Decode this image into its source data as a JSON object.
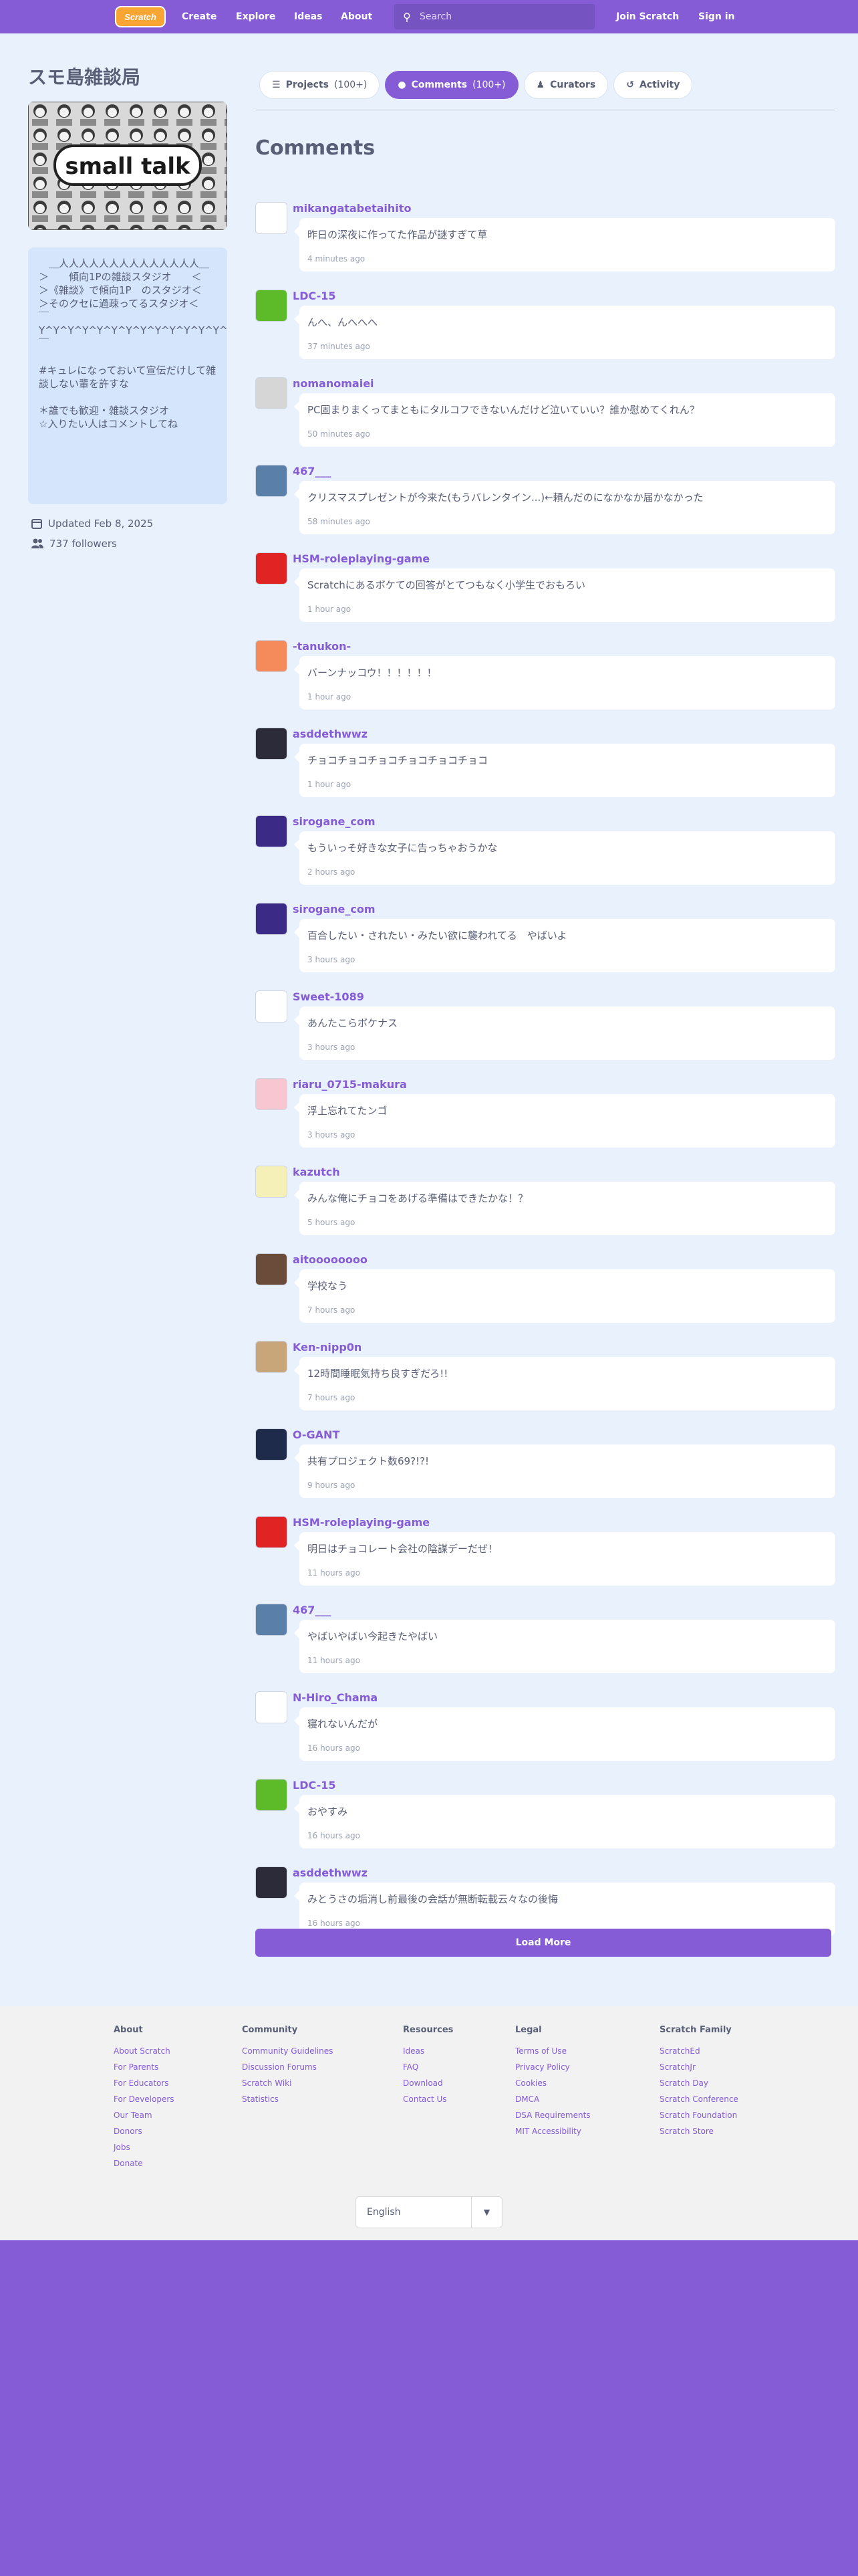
{
  "nav": {
    "logo": "Scratch",
    "create": "Create",
    "explore": "Explore",
    "ideas": "Ideas",
    "about": "About",
    "search_placeholder": "Search",
    "join": "Join Scratch",
    "signin": "Sign in"
  },
  "studio": {
    "title": "スモ島雑談局",
    "thumb_text": "small talk",
    "description": "　＿人人人人人人人人人人人人人人＿\n＞　　傾向1Pの雑談スタジオ　　＜\n＞《雑談》で傾向1P　のスタジオ＜\n＞そのクセに過疎ってるスタジオ＜\n￣Y^Y^Y^Y^Y^Y^Y^Y^Y^Y^Y^Y^Y^Y^￣\n\n#キュレになっておいて宣伝だけして雑談しない輩を許すな\n\n＊誰でも歓迎・雑談スタジオ\n☆入りたい人はコメントしてね",
    "updated": "Updated Feb 8, 2025",
    "followers": "737 followers"
  },
  "tabs": [
    {
      "label": "Projects",
      "count": "(100+)"
    },
    {
      "label": "Comments",
      "count": "(100+)"
    },
    {
      "label": "Curators",
      "count": ""
    },
    {
      "label": "Activity",
      "count": ""
    }
  ],
  "comments_heading": "Comments",
  "comments": [
    {
      "user": "mikangatabetaihito",
      "text": "昨日の深夜に作ってた作品が謎すぎて草",
      "time": "4 minutes ago",
      "avatar_color": "#ffffff"
    },
    {
      "user": "LDC-15",
      "text": "んへ、んへへへ",
      "time": "37 minutes ago",
      "avatar_color": "#5dbb2a"
    },
    {
      "user": "nomanomaiei",
      "text": "PC固まりまくってまともにタルコフできないんだけど泣いていい？誰か慰めてくれん？",
      "time": "50 minutes ago",
      "avatar_color": "#d6d6d6"
    },
    {
      "user": "467___",
      "text": "クリスマスプレゼントが今来た(もうバレンタイン...)←頼んだのになかなか届かなかった",
      "time": "58 minutes ago",
      "avatar_color": "#5a7fa8"
    },
    {
      "user": "HSM-roleplaying-game",
      "text": "Scratchにあるボケての回答がとてつもなく小学生でおもろい",
      "time": "1 hour ago",
      "avatar_color": "#e02424"
    },
    {
      "user": "-tanukon-",
      "text": "バーンナッコウ！！！！！！",
      "time": "1 hour ago",
      "avatar_color": "#f58a5a"
    },
    {
      "user": "asddethwwz",
      "text": "チョコチョコチョコチョコチョコチョコ",
      "time": "1 hour ago",
      "avatar_color": "#2c2b3a"
    },
    {
      "user": "sirogane_com",
      "text": "もういっそ好きな女子に告っちゃおうかな",
      "time": "2 hours ago",
      "avatar_color": "#3b2a86"
    },
    {
      "user": "sirogane_com",
      "text": "百合したい・されたい・みたい欲に襲われてる　やばいよ",
      "time": "3 hours ago",
      "avatar_color": "#3b2a86"
    },
    {
      "user": "Sweet-1089",
      "text": "あんたこらボケナス",
      "time": "3 hours ago",
      "avatar_color": "#ffffff"
    },
    {
      "user": "riaru_0715-makura",
      "text": "浮上忘れてたンゴ",
      "time": "3 hours ago",
      "avatar_color": "#f7c6d0"
    },
    {
      "user": "kazutch",
      "text": "みんな俺にチョコをあげる準備はできたかな！？",
      "time": "5 hours ago",
      "avatar_color": "#f4f0b8"
    },
    {
      "user": "aitoooooooo",
      "text": "学校なう",
      "time": "7 hours ago",
      "avatar_color": "#6b4b3a"
    },
    {
      "user": "Ken-nipp0n",
      "text": "12時間睡眠気持ち良すぎだろ!!",
      "time": "7 hours ago",
      "avatar_color": "#c9a57a"
    },
    {
      "user": "O-GANT",
      "text": "共有プロジェクト数69?!?!",
      "time": "9 hours ago",
      "avatar_color": "#1e2b4a"
    },
    {
      "user": "HSM-roleplaying-game",
      "text": "明日はチョコレート会社の陰謀デーだぜ！",
      "time": "11 hours ago",
      "avatar_color": "#e02424"
    },
    {
      "user": "467___",
      "text": "やばいやばい今起きたやばい",
      "time": "11 hours ago",
      "avatar_color": "#5a7fa8"
    },
    {
      "user": "N-Hiro_Chama",
      "text": "寝れないんだが",
      "time": "16 hours ago",
      "avatar_color": "#ffffff"
    },
    {
      "user": "LDC-15",
      "text": "おやすみ",
      "time": "16 hours ago",
      "avatar_color": "#5dbb2a"
    },
    {
      "user": "asddethwwz",
      "text": "みとうさの垢消し前最後の会話が無断転載云々なの後悔",
      "time": "16 hours ago",
      "avatar_color": "#2c2b3a"
    }
  ],
  "load_more": "Load More",
  "footer": {
    "columns": [
      {
        "title": "About",
        "links": [
          "About Scratch",
          "For Parents",
          "For Educators",
          "For Developers",
          "Our Team",
          "Donors",
          "Jobs",
          "Donate"
        ]
      },
      {
        "title": "Community",
        "links": [
          "Community Guidelines",
          "Discussion Forums",
          "Scratch Wiki",
          "Statistics"
        ]
      },
      {
        "title": "Resources",
        "links": [
          "Ideas",
          "FAQ",
          "Download",
          "Contact Us"
        ]
      },
      {
        "title": "Legal",
        "links": [
          "Terms of Use",
          "Privacy Policy",
          "Cookies",
          "DMCA",
          "DSA Requirements",
          "MIT Accessibility"
        ]
      },
      {
        "title": "Scratch Family",
        "links": [
          "ScratchEd",
          "ScratchJr",
          "Scratch Day",
          "Scratch Conference",
          "Scratch Foundation",
          "Scratch Store"
        ]
      }
    ],
    "language": "English"
  },
  "colors": {
    "brand": "#855cd6",
    "page_bg": "#e9f1fc",
    "logo": "#f9a534"
  }
}
